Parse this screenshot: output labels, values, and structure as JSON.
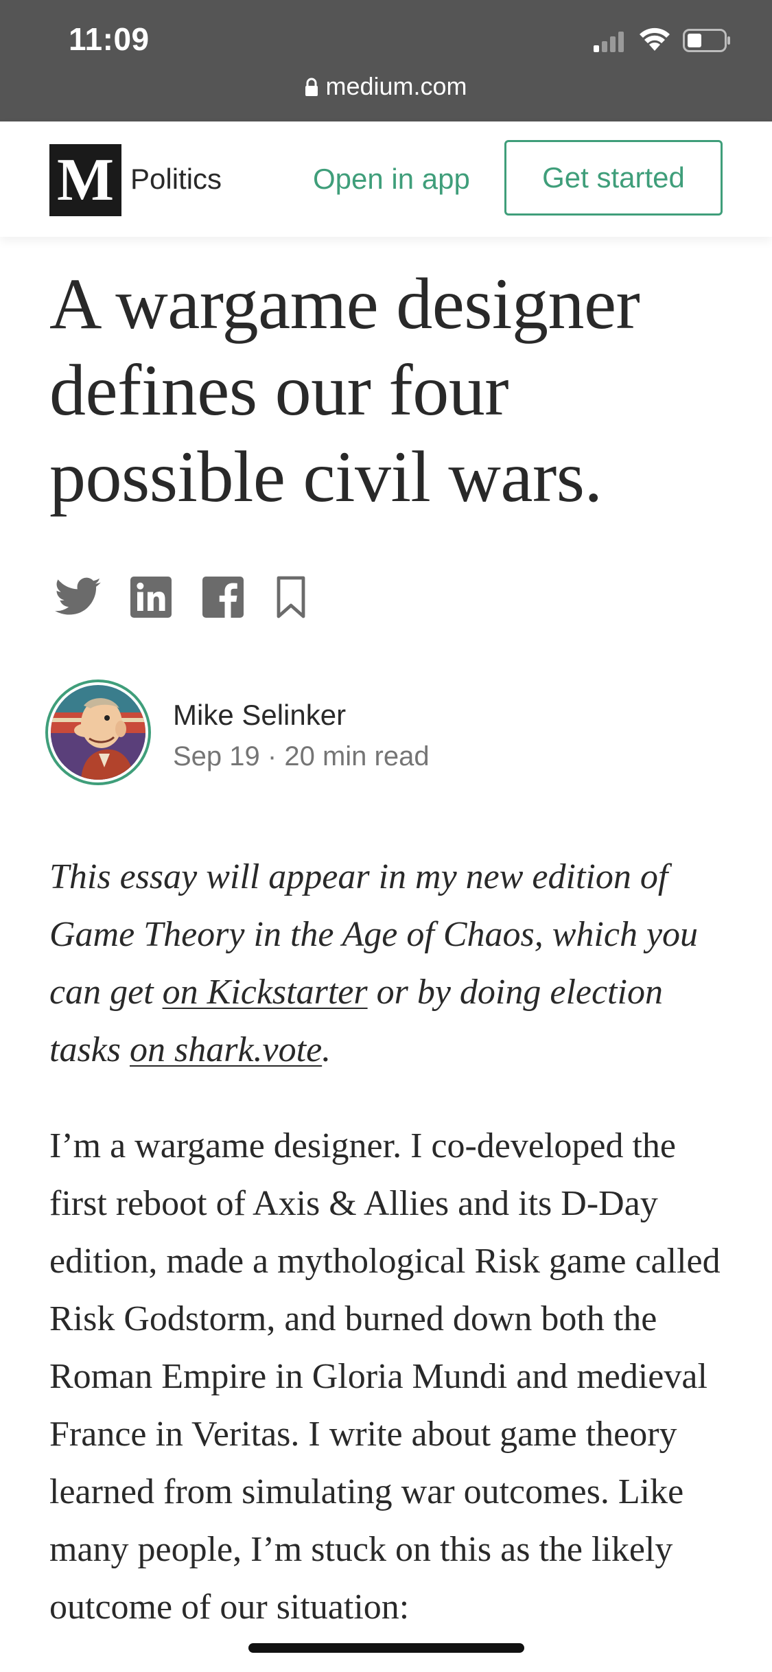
{
  "status_bar": {
    "time": "11:09",
    "icons": [
      "cellular-signal-icon",
      "wifi-icon",
      "battery-icon"
    ]
  },
  "url_bar": {
    "domain": "medium.com",
    "icon": "lock-icon"
  },
  "header": {
    "logo_letter": "M",
    "section": "Politics",
    "open_in_app": "Open in app",
    "get_started": "Get started",
    "accent_color": "#3f9e7a"
  },
  "article": {
    "title": "A wargame designer defines our four possible civil wars.",
    "share_icons": [
      "twitter-icon",
      "linkedin-icon",
      "facebook-icon",
      "bookmark-icon"
    ],
    "author": {
      "name": "Mike Selinker",
      "date": "Sep 19",
      "separator": "·",
      "read_time": "20 min read"
    },
    "intro": {
      "part1": "This essay will appear in my new edition of Game Theory in the Age of Chaos, which you can get ",
      "link1": "on Kickstarter",
      "part2": " or by doing election tasks ",
      "link2": "on shark.vote",
      "part3": "."
    },
    "body": "I’m a wargame designer. I co-developed the first reboot of Axis & Allies and its D-Day edition, made a mythological Risk game called Risk Godstorm, and burned down both the Roman Empire in Gloria Mundi and medieval France in Veritas. I write about game theory learned from simulating war outcomes. Like many people, I’m stuck on this as the likely outcome of our situation:"
  }
}
